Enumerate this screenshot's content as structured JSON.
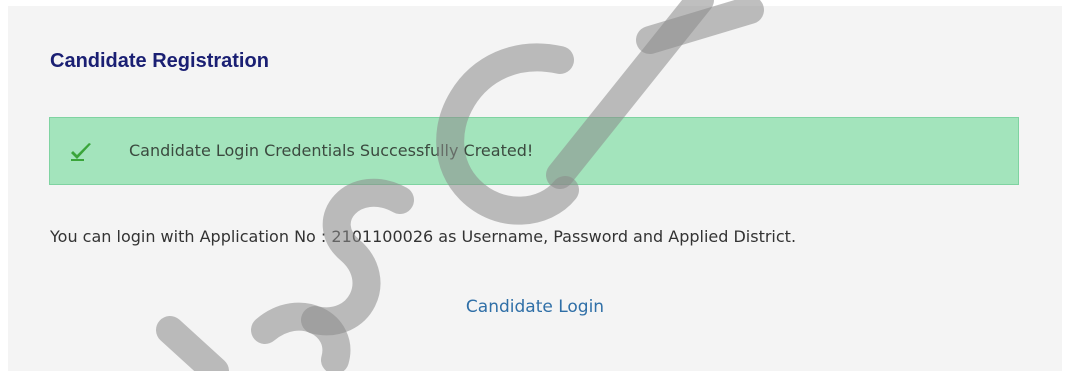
{
  "page": {
    "title": "Candidate Registration"
  },
  "alert": {
    "icon": "check-icon",
    "message": "Candidate Login Credentials Successfully Created!",
    "background_color": "#a3e4bc",
    "icon_color": "#3aa53a"
  },
  "info": {
    "text": "You can login with Application No : 2101100026 as Username, Password and Applied District."
  },
  "login_link": {
    "label": "Candidate Login",
    "color": "#2f6fa7"
  },
  "watermark": {
    "text": "bsCA"
  }
}
